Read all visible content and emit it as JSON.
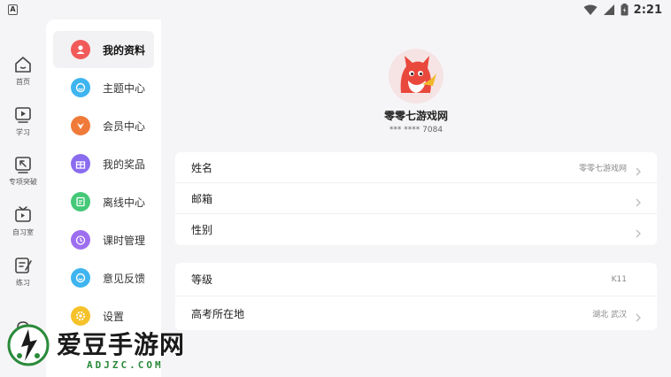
{
  "status_bar": {
    "app_badge": "A",
    "time": "2:21"
  },
  "rail": [
    {
      "label": "首页",
      "icon": "home-icon"
    },
    {
      "label": "学习",
      "icon": "play-icon"
    },
    {
      "label": "专项突破",
      "icon": "target-icon"
    },
    {
      "label": "自习室",
      "icon": "tv-icon"
    },
    {
      "label": "练习",
      "icon": "edit-icon"
    }
  ],
  "menu": [
    {
      "label": "我的资料",
      "icon": "user-icon",
      "color": "#f25a5a",
      "active": true
    },
    {
      "label": "主题中心",
      "icon": "smile-icon",
      "color": "#3fb5f0"
    },
    {
      "label": "会员中心",
      "icon": "vip-icon",
      "color": "#f07a3a"
    },
    {
      "label": "我的奖品",
      "icon": "gift-icon",
      "color": "#8a6cf0"
    },
    {
      "label": "离线中心",
      "icon": "offline-icon",
      "color": "#45c878"
    },
    {
      "label": "课时管理",
      "icon": "clock-icon",
      "color": "#9d6ef0"
    },
    {
      "label": "意见反馈",
      "icon": "feedback-icon",
      "color": "#3fb5f0"
    },
    {
      "label": "设置",
      "icon": "gear-icon",
      "color": "#f5c22a"
    }
  ],
  "profile": {
    "name": "零零七游戏网",
    "phone": "*** **** 7084"
  },
  "card1": [
    {
      "label": "姓名",
      "value": "零零七游戏网"
    },
    {
      "label": "邮箱",
      "value": ""
    },
    {
      "label": "性别",
      "value": ""
    }
  ],
  "card2": [
    {
      "label": "等级",
      "value": "K11"
    },
    {
      "label": "高考所在地",
      "value": "湖北 武汉"
    }
  ],
  "watermark": {
    "title": "爱豆手游网",
    "url": "ADJZC.COM"
  }
}
